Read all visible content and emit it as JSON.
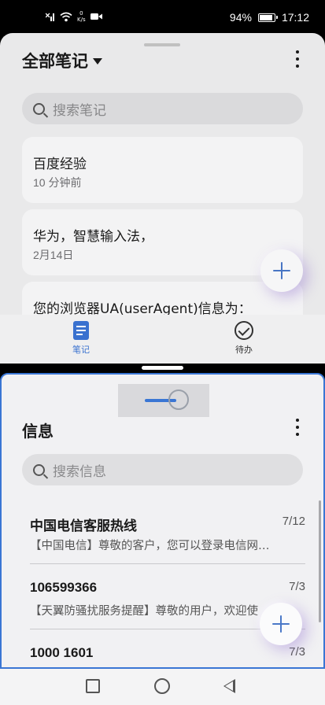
{
  "status_bar": {
    "network_speed": "0",
    "network_unit": "K/s",
    "battery_percent": "94%",
    "battery_level": 0.94,
    "time": "17:12"
  },
  "notes_app": {
    "title": "全部笔记",
    "search_placeholder": "搜索笔记",
    "notes": [
      {
        "title": "百度经验",
        "time": "10 分钟前"
      },
      {
        "title": "华为，智慧输入法，",
        "time": "2月14日"
      },
      {
        "title": "您的浏览器UA(userAgent)信息为：",
        "time": ""
      }
    ],
    "nav": {
      "notes_label": "笔记",
      "todo_label": "待办"
    }
  },
  "messages_app": {
    "title": "信息",
    "search_placeholder": "搜索信息",
    "messages": [
      {
        "sender": "中国电信客服热线",
        "date": "7/12",
        "preview": "【中国电信】尊敬的客户，您可以登录电信网…"
      },
      {
        "sender": "106599366",
        "date": "7/3",
        "preview": "【天翼防骚扰服务提醒】尊敬的用户，欢迎使"
      },
      {
        "sender": "1000 1601",
        "date": "7/3",
        "preview": ""
      }
    ]
  },
  "colors": {
    "accent": "#3a76d4",
    "fab_plus": "#4a78c8"
  }
}
